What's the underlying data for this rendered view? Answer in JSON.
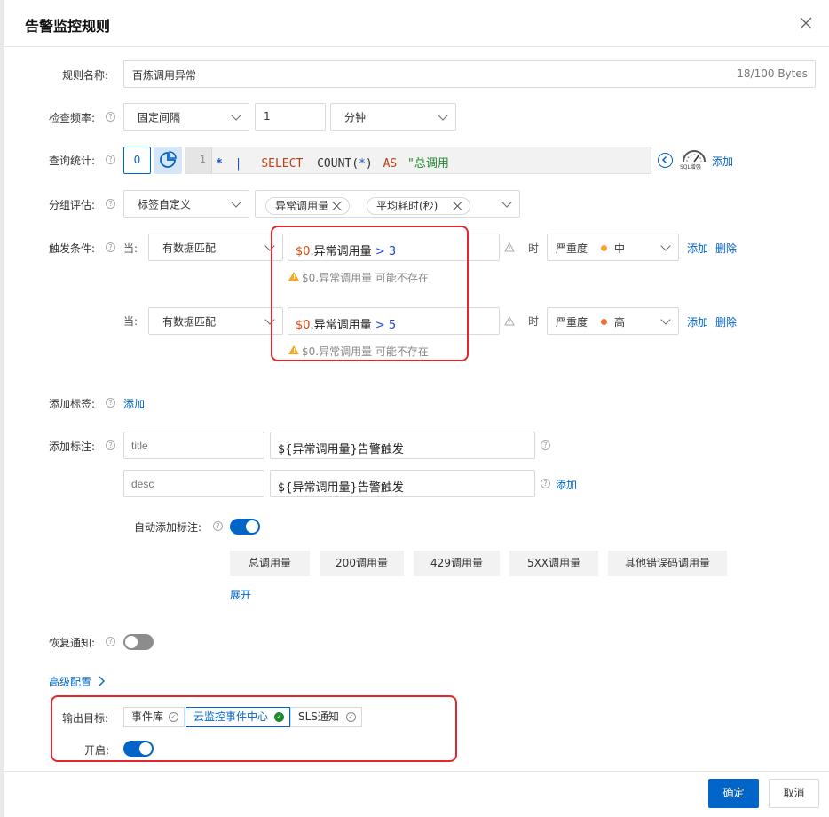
{
  "dialog": {
    "title": "告警监控规则",
    "confirm_label": "确定",
    "cancel_label": "取消"
  },
  "rule_name": {
    "label": "规则名称:",
    "value": "百炼调用异常",
    "counter": "18/100 Bytes"
  },
  "check_frequency": {
    "label": "检查频率:",
    "mode": "固定间隔",
    "interval_value": "1",
    "unit": "分钟"
  },
  "query": {
    "label": "查询统计:",
    "index_value": "0",
    "line_number": "1",
    "code_star": "*",
    "code_pipe": "|",
    "code_select": "SELECT",
    "code_func": "COUNT(",
    "code_arg": "*",
    "code_close": ")",
    "code_as": "AS",
    "code_str": "\"总调用",
    "sql_logo_text": "SQL增强",
    "add_label": "添加"
  },
  "group_eval": {
    "label": "分组评估:",
    "mode": "标签自定义",
    "tags": [
      "异常调用量",
      "平均耗时(秒)"
    ]
  },
  "trigger": {
    "label": "触发条件:",
    "conditions": [
      {
        "when_label": "当:",
        "match_mode": "有数据匹配",
        "expr_var": "$0",
        "expr_field": ".异常调用量",
        "expr_op": "> 3",
        "warning": "$0.异常调用量 可能不存在",
        "time_label": "时",
        "severity_label": "严重度",
        "severity_value": "中",
        "severity_color": "#f5a623",
        "add_label": "添加",
        "delete_label": "删除"
      },
      {
        "when_label": "当:",
        "match_mode": "有数据匹配",
        "expr_var": "$0",
        "expr_field": ".异常调用量",
        "expr_op": "> 5",
        "warning": "$0.异常调用量 可能不存在",
        "time_label": "时",
        "severity_label": "严重度",
        "severity_value": "高",
        "severity_color": "#f06e3c",
        "add_label": "添加",
        "delete_label": "删除"
      }
    ]
  },
  "labels": {
    "label": "添加标签:",
    "add_label": "添加"
  },
  "annotations": {
    "label": "添加标注:",
    "rows": [
      {
        "key_placeholder": "title",
        "value": "${异常调用量}告警触发"
      },
      {
        "key_placeholder": "desc",
        "value": "${异常调用量}告警触发"
      }
    ],
    "add_label": "添加",
    "auto_label": "自动添加标注:",
    "auto_enabled": true,
    "chips": [
      "总调用量",
      "200调用量",
      "429调用量",
      "5XX调用量",
      "其他错误码调用量"
    ],
    "expand_label": "展开"
  },
  "recovery": {
    "label": "恢复通知:",
    "enabled": false
  },
  "advanced": {
    "label": "高级配置",
    "output_label": "输出目标:",
    "outputs": [
      {
        "label": "事件库",
        "selected": false
      },
      {
        "label": "云监控事件中心",
        "selected": true
      },
      {
        "label": "SLS通知",
        "selected": false
      }
    ],
    "enable_label": "开启:",
    "enabled": true
  },
  "colors": {
    "primary": "#0064c8",
    "toggle_on": "#0064c8",
    "toggle_off": "#8c8c8c",
    "highlight_frame": "#e0282e",
    "warning": "#f5a623"
  }
}
